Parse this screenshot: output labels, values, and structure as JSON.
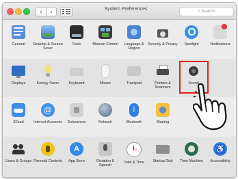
{
  "window": {
    "title": "System Preferences",
    "search_placeholder": "Search",
    "back_glyph": "‹",
    "forward_glyph": "›"
  },
  "rows": [
    {
      "items": [
        {
          "label": "General",
          "icon": "general-icon"
        },
        {
          "label": "Desktop & Screen Saver",
          "icon": "desktop-screen-saver-icon"
        },
        {
          "label": "Dock",
          "icon": "dock-icon"
        },
        {
          "label": "Mission Control",
          "icon": "mission-control-icon"
        },
        {
          "label": "Language & Region",
          "icon": "language-region-icon"
        },
        {
          "label": "Security & Privacy",
          "icon": "security-privacy-icon"
        },
        {
          "label": "Spotlight",
          "icon": "spotlight-icon"
        },
        {
          "label": "Notifications",
          "icon": "notifications-icon"
        }
      ]
    },
    {
      "items": [
        {
          "label": "Displays",
          "icon": "displays-icon"
        },
        {
          "label": "Energy Saver",
          "icon": "energy-saver-icon"
        },
        {
          "label": "Keyboard",
          "icon": "keyboard-icon"
        },
        {
          "label": "Mouse",
          "icon": "mouse-icon"
        },
        {
          "label": "Trackpad",
          "icon": "trackpad-icon"
        },
        {
          "label": "Printers & Scanners",
          "icon": "printers-scanners-icon"
        },
        {
          "label": "Sound",
          "icon": "sound-icon"
        }
      ]
    },
    {
      "items": [
        {
          "label": "iCloud",
          "icon": "icloud-icon"
        },
        {
          "label": "Internet Accounts",
          "icon": "internet-accounts-icon"
        },
        {
          "label": "Extensions",
          "icon": "extensions-icon"
        },
        {
          "label": "Network",
          "icon": "network-icon"
        },
        {
          "label": "Bluetooth",
          "icon": "bluetooth-icon"
        },
        {
          "label": "Sharing",
          "icon": "sharing-icon"
        }
      ]
    },
    {
      "items": [
        {
          "label": "Users & Groups",
          "icon": "users-groups-icon"
        },
        {
          "label": "Parental Controls",
          "icon": "parental-controls-icon"
        },
        {
          "label": "App Store",
          "icon": "app-store-icon"
        },
        {
          "label": "Dictation & Speech",
          "icon": "dictation-speech-icon"
        },
        {
          "label": "Date & Time",
          "icon": "date-time-icon"
        },
        {
          "label": "Startup Disk",
          "icon": "startup-disk-icon"
        },
        {
          "label": "Time Machine",
          "icon": "time-machine-icon"
        },
        {
          "label": "Accessibility",
          "icon": "accessibility-icon"
        }
      ]
    }
  ],
  "highlighted_pane": "Sound",
  "colors": {
    "highlight": "#e02020"
  }
}
